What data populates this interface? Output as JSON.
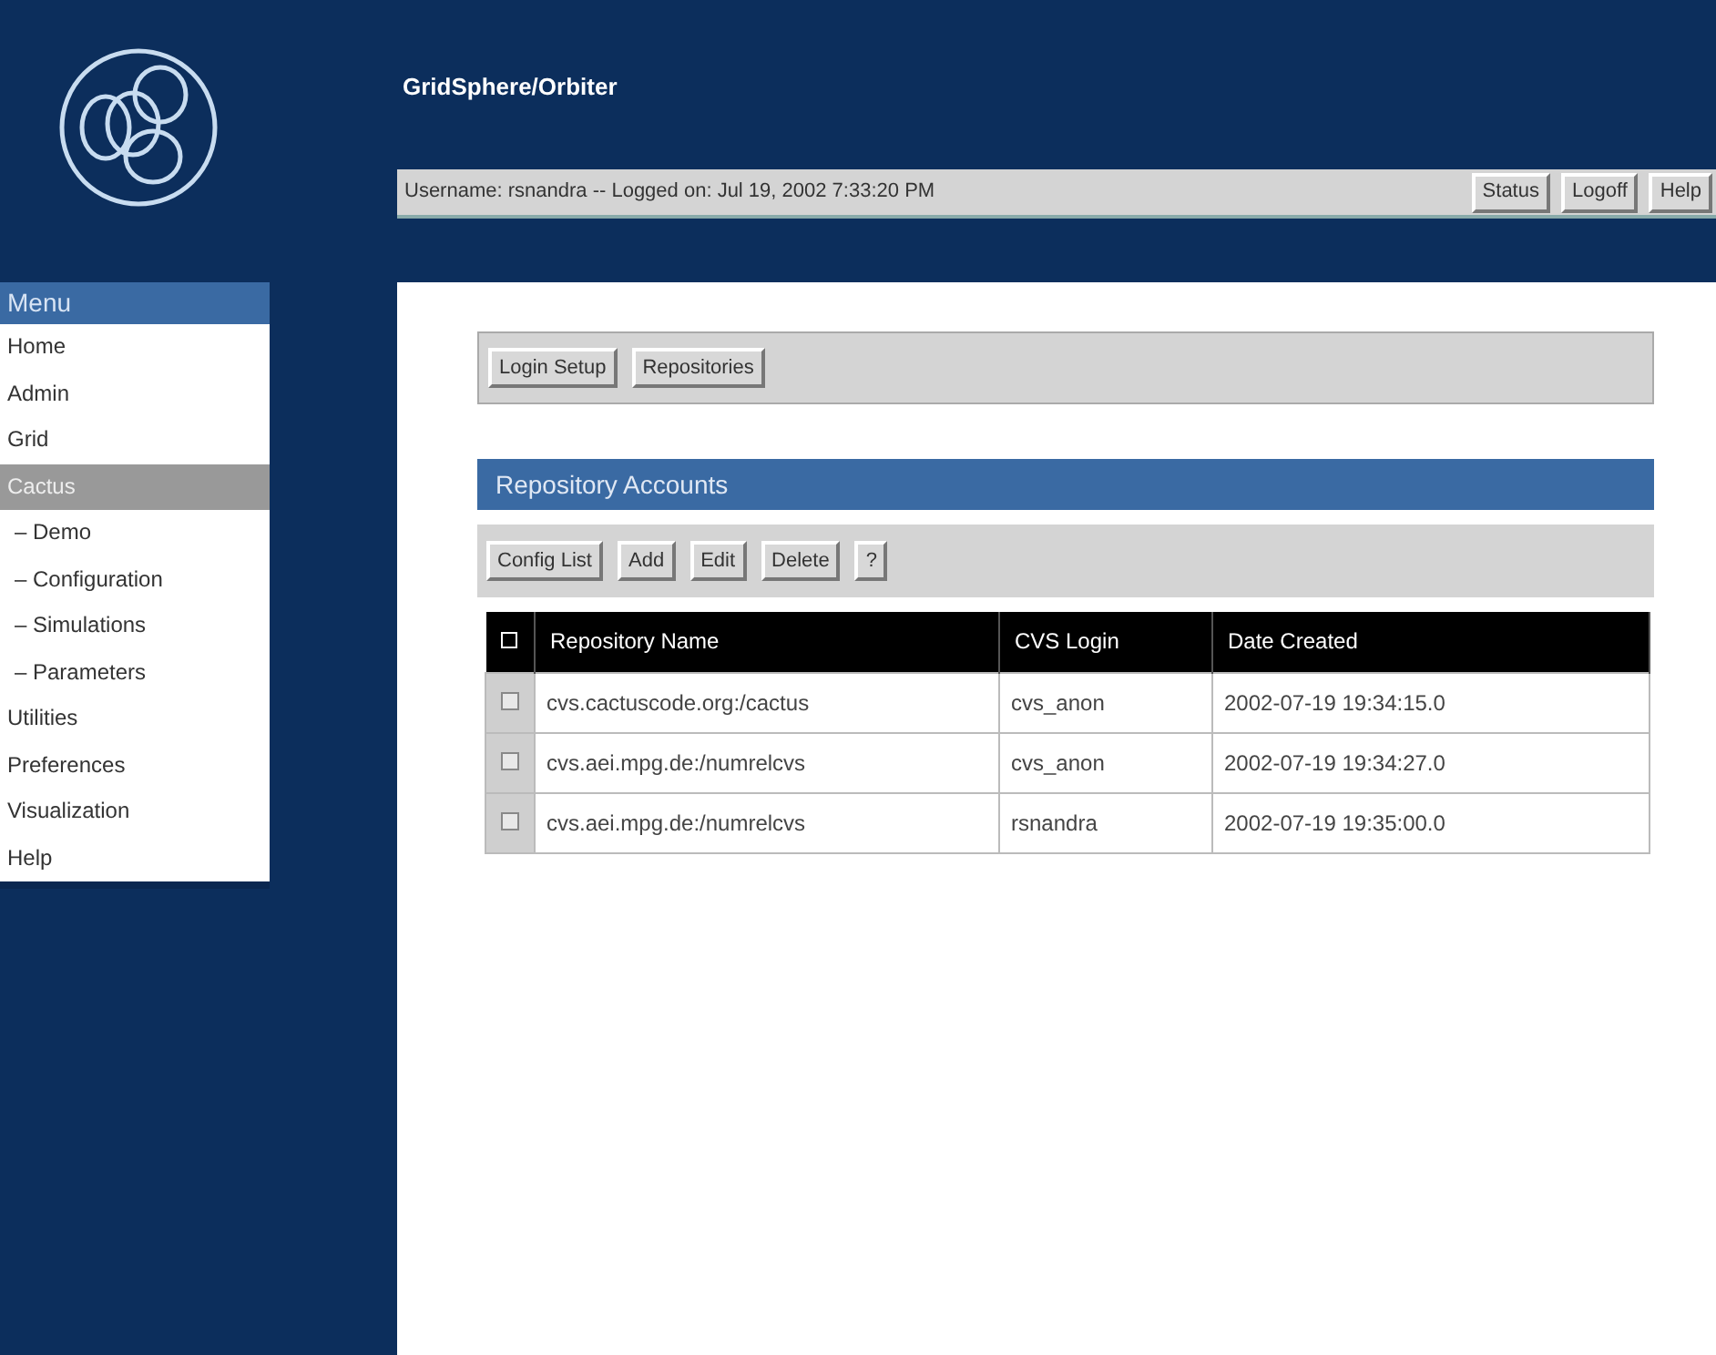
{
  "header": {
    "title": "GridSphere/Orbiter",
    "session": "Username: rsnandra --  Logged on: Jul 19, 2002 7:33:20 PM",
    "buttons": [
      "Status",
      "Logoff",
      "Help"
    ]
  },
  "menu": {
    "title": "Menu",
    "items": [
      {
        "label": "Home",
        "selected": false
      },
      {
        "label": "Admin",
        "selected": false
      },
      {
        "label": "Grid",
        "selected": false
      },
      {
        "label": "Cactus",
        "selected": true,
        "children": [
          {
            "label": "– Demo",
            "selected": false
          },
          {
            "label": "– Configuration",
            "selected": false
          },
          {
            "label": "– Simulations",
            "selected": false
          },
          {
            "label": "– Parameters",
            "selected": false
          }
        ]
      },
      {
        "label": "Utilities",
        "selected": false
      },
      {
        "label": "Preferences",
        "selected": false
      },
      {
        "label": "Visualization",
        "selected": false
      },
      {
        "label": "Help",
        "selected": false
      }
    ]
  },
  "nav_buttons": [
    "Login Setup",
    "Repositories"
  ],
  "section": {
    "title": "Repository Accounts",
    "toolbar": [
      "Config List",
      "Add",
      "Edit",
      "Delete",
      "?"
    ],
    "table": {
      "select_all_checked": false,
      "columns": [
        "Repository Name",
        "CVS Login",
        "Date Created"
      ],
      "rows": [
        {
          "checked": false,
          "cells": [
            "cvs.cactuscode.org:/cactus",
            "cvs_anon",
            "2002-07-19 19:34:15.0"
          ]
        },
        {
          "checked": false,
          "cells": [
            "cvs.aei.mpg.de:/numrelcvs",
            "cvs_anon",
            "2002-07-19 19:34:27.0"
          ]
        },
        {
          "checked": false,
          "cells": [
            "cvs.aei.mpg.de:/numrelcvs",
            "rsnandra",
            "2002-07-19 19:35:00.0"
          ]
        }
      ]
    }
  }
}
